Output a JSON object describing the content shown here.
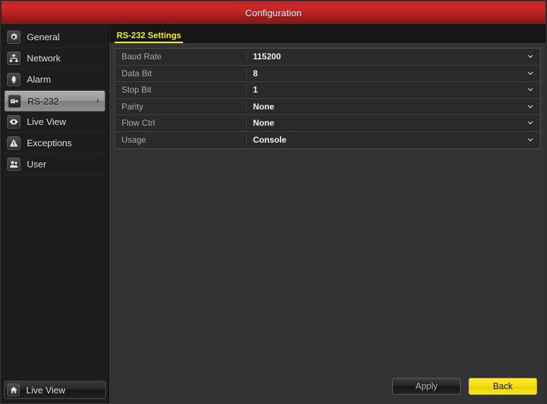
{
  "window": {
    "title": "Configuration",
    "accent_red": "#c02424",
    "accent_yellow": "#f3f01e"
  },
  "sidebar": {
    "items": [
      {
        "label": "General",
        "icon": "gear-icon",
        "selected": false
      },
      {
        "label": "Network",
        "icon": "network-icon",
        "selected": false
      },
      {
        "label": "Alarm",
        "icon": "alarm-icon",
        "selected": false
      },
      {
        "label": "RS-232",
        "icon": "serial-icon",
        "selected": true,
        "arrow": "›"
      },
      {
        "label": "Live View",
        "icon": "eye-icon",
        "selected": false
      },
      {
        "label": "Exceptions",
        "icon": "warning-icon",
        "selected": false
      },
      {
        "label": "User",
        "icon": "users-icon",
        "selected": false
      }
    ],
    "bottom": {
      "label": "Live View",
      "icon": "home-icon"
    }
  },
  "main": {
    "tab_label": "RS-232 Settings",
    "settings": [
      {
        "label": "Baud Rate",
        "value": "115200",
        "control": "dropdown"
      },
      {
        "label": "Data Bit",
        "value": "8",
        "control": "dropdown"
      },
      {
        "label": "Stop Bit",
        "value": "1",
        "control": "dropdown"
      },
      {
        "label": "Parity",
        "value": "None",
        "control": "dropdown"
      },
      {
        "label": "Flow Ctrl",
        "value": "None",
        "control": "dropdown"
      },
      {
        "label": "Usage",
        "value": "Console",
        "control": "dropdown"
      }
    ],
    "footer": {
      "apply_label": "Apply",
      "back_label": "Back"
    }
  }
}
